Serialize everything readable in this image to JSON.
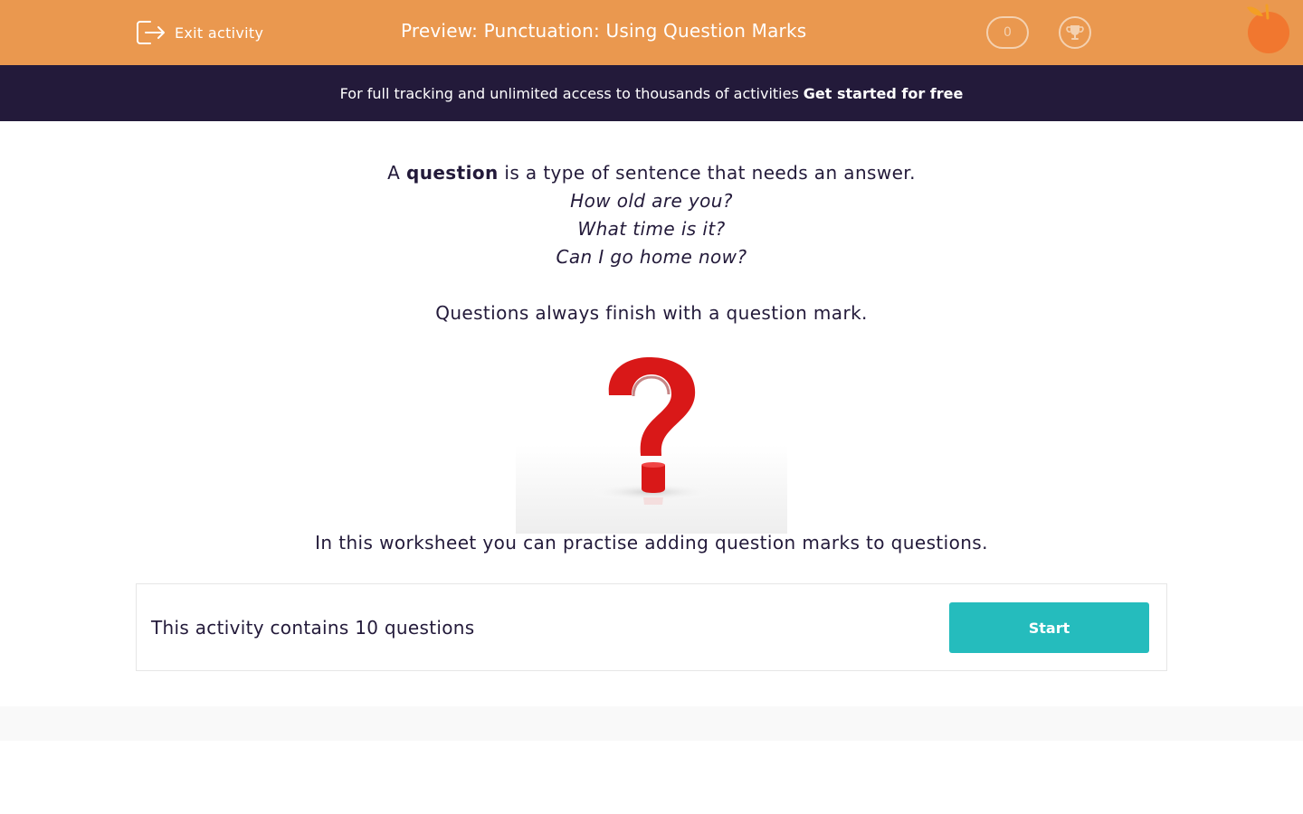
{
  "header": {
    "exit_label": "Exit activity",
    "title": "Preview: Punctuation: Using Question Marks",
    "score": "0"
  },
  "banner": {
    "text": "For full tracking and unlimited access to thousands of activities",
    "link": "Get started for free"
  },
  "intro": {
    "part1": "A ",
    "keyword": "question",
    "part2": " is a type of sentence that needs an answer.",
    "examples": [
      "How old are you?",
      "What time is it?",
      "Can I go home now?"
    ],
    "rule": "Questions always finish with a question mark.",
    "worksheet": "In this worksheet you can practise adding question marks to questions."
  },
  "activity": {
    "count_text": "This activity contains 10 questions",
    "start_label": "Start"
  },
  "colors": {
    "header_bg": "#ea984f",
    "banner_bg": "#231a3a",
    "accent_teal": "#25bcbd",
    "question_mark_red": "#d91818"
  }
}
